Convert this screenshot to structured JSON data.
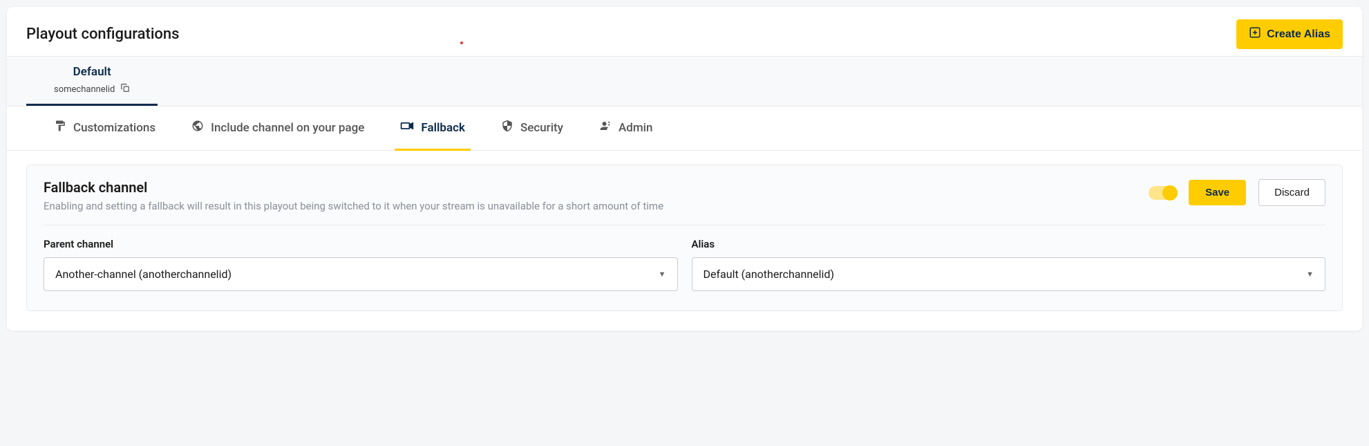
{
  "header": {
    "title": "Playout configurations",
    "create_label": "Create Alias"
  },
  "alias": {
    "name": "Default",
    "id": "somechannelid"
  },
  "tabs": [
    {
      "label": "Customizations"
    },
    {
      "label": "Include channel on your page"
    },
    {
      "label": "Fallback"
    },
    {
      "label": "Security"
    },
    {
      "label": "Admin"
    }
  ],
  "panel": {
    "title": "Fallback channel",
    "description": "Enabling and setting a fallback will result in this playout being switched to it when your stream is unavailable for a short amount of time",
    "save_label": "Save",
    "discard_label": "Discard"
  },
  "fields": {
    "parent_label": "Parent channel",
    "parent_value": "Another-channel (anotherchannelid)",
    "alias_label": "Alias",
    "alias_value": "Default (anotherchannelid)"
  }
}
